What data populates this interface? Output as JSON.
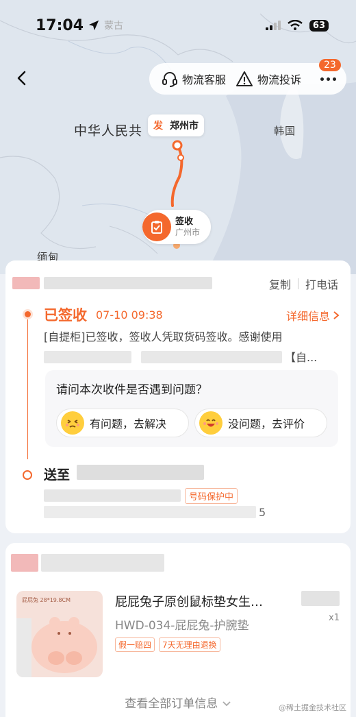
{
  "status_bar": {
    "time": "17:04",
    "location_label": "蒙古",
    "battery": "63"
  },
  "nav": {
    "customer_service": "物流客服",
    "complaint": "物流投诉",
    "more_badge": "23"
  },
  "map": {
    "country_label": "中华人民共",
    "korea_label": "韩国",
    "myanmar_label": "缅甸",
    "origin_badge": "发",
    "origin_city": "郑州市",
    "dest_status": "签收",
    "dest_city": "广州市",
    "accent_color": "#f4682d"
  },
  "tracking": {
    "copy_label": "复制",
    "call_label": "打电话",
    "status_title": "已签收",
    "status_time": "07-10 09:38",
    "detail_link": "详细信息",
    "description": "[自提柜]已签收，签收人凭取货码签收。感谢使用",
    "description_tail": "【自...",
    "question": "请问本次收件是否遇到问题？",
    "problem_button": "有问题，去解决",
    "no_problem_button": "没问题，去评价",
    "send_to_label": "送至",
    "privacy_tag": "号码保护中",
    "address_tail": "5"
  },
  "order": {
    "product_image_brand": "屁屁兔 28*19.8CM",
    "product_title": "屁屁兔子原创鼠标垫女生…",
    "product_sku": "HWD-034-屁屁兔-护腕垫",
    "tags": [
      "假一赔四",
      "7天无理由退换"
    ],
    "quantity": "x1",
    "view_all": "查看全部订单信息"
  },
  "watermark": "@稀土掘金技术社区"
}
